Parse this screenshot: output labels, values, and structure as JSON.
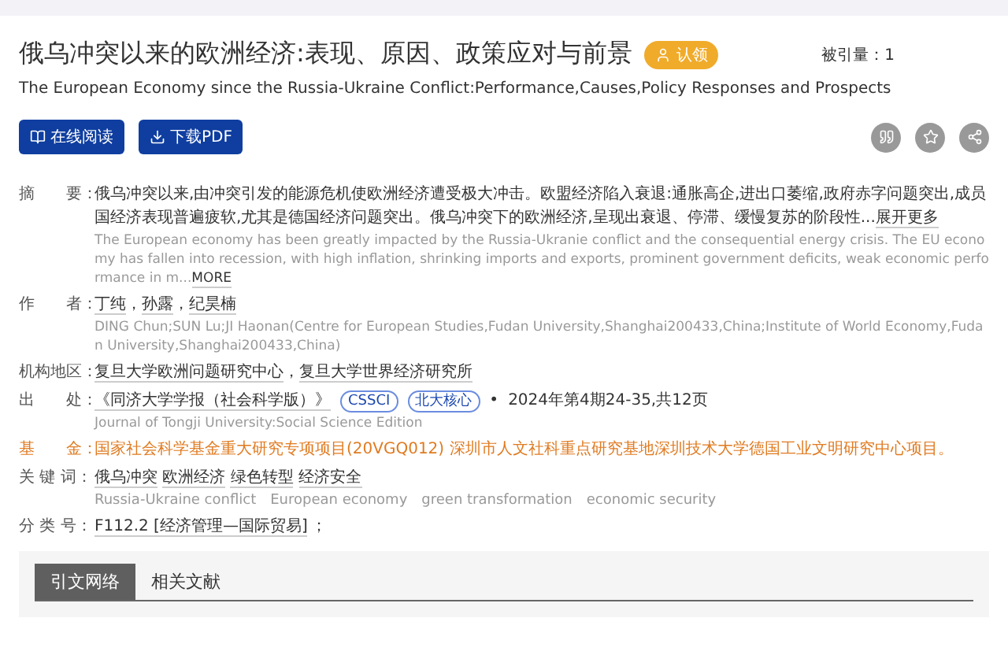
{
  "title": "俄乌冲突以来的欧洲经济:表现、原因、政策应对与前景",
  "claim_badge": "认领",
  "cited": {
    "label": "被引量：",
    "value": "1"
  },
  "subtitle_en": "The European Economy since the Russia-Ukraine Conflict:Performance,Causes,Policy Responses and Prospects",
  "buttons": [
    {
      "label": "在线阅读",
      "kind": "read"
    },
    {
      "label": "下载PDF",
      "kind": "download"
    }
  ],
  "abstract": {
    "label": "摘　　要：",
    "text_zh": "俄乌冲突以来,由冲突引发的能源危机使欧洲经济遭受极大冲击。欧盟经济陷入衰退:通胀高企,进出口萎缩,政府赤字问题突出,成员国经济表现普遍疲软,尤其是德国经济问题突出。俄乌冲突下的欧洲经济,呈现出衰退、停滞、缓慢复苏的阶段性...",
    "more_zh": "展开更多",
    "text_en": "The European economy has been greatly impacted by the Russia-Ukranie conflict and the consequential energy crisis. The EU economy has fallen into recession, with high inflation, shrinking imports and exports, prominent government deficits, weak economic performance in m...",
    "more_en": "MORE"
  },
  "authors": {
    "label": "作　　者：",
    "separator": "，",
    "names": [
      "丁纯",
      "孙露",
      "纪昊楠"
    ],
    "detail": "DING Chun;SUN Lu;JI Haonan(Centre for European Studies,Fudan University,Shanghai200433,China;Institute of World Economy,Fudan University,Shanghai200433,China)"
  },
  "institutions": {
    "label": "机构地区：",
    "separator": "，",
    "names": [
      "复旦大学欧洲问题研究中心",
      "复旦大学世界经济研究所"
    ]
  },
  "source": {
    "label": "出　　处：",
    "journal": "《同济大学学报（社会科学版）》",
    "tags": [
      "CSSCI",
      "北大核心"
    ],
    "bullet": "•",
    "issue": "2024年第4期24-35,共12页",
    "journal_en": "Journal of Tongji University:Social Science Edition"
  },
  "fund": {
    "label": "基　　金：",
    "text": "国家社会科学基金重大研究专项项目(20VGQ012) 深圳市人文社科重点研究基地深圳技术大学德国工业文明研究中心项目。"
  },
  "keywords": {
    "label": "关 键 词：",
    "zh": [
      "俄乌冲突",
      "欧洲经济",
      "绿色转型",
      "经济安全"
    ],
    "en": [
      "Russia-Ukraine conflict",
      "European economy",
      "green transformation",
      "economic security"
    ]
  },
  "classification": {
    "label": "分 类 号：",
    "code": "F112.2 [经济管理—国际贸易]",
    "suffix": "；"
  },
  "tabs": [
    {
      "label": "引文网络",
      "selected": true
    },
    {
      "label": "相关文献",
      "selected": false
    }
  ]
}
